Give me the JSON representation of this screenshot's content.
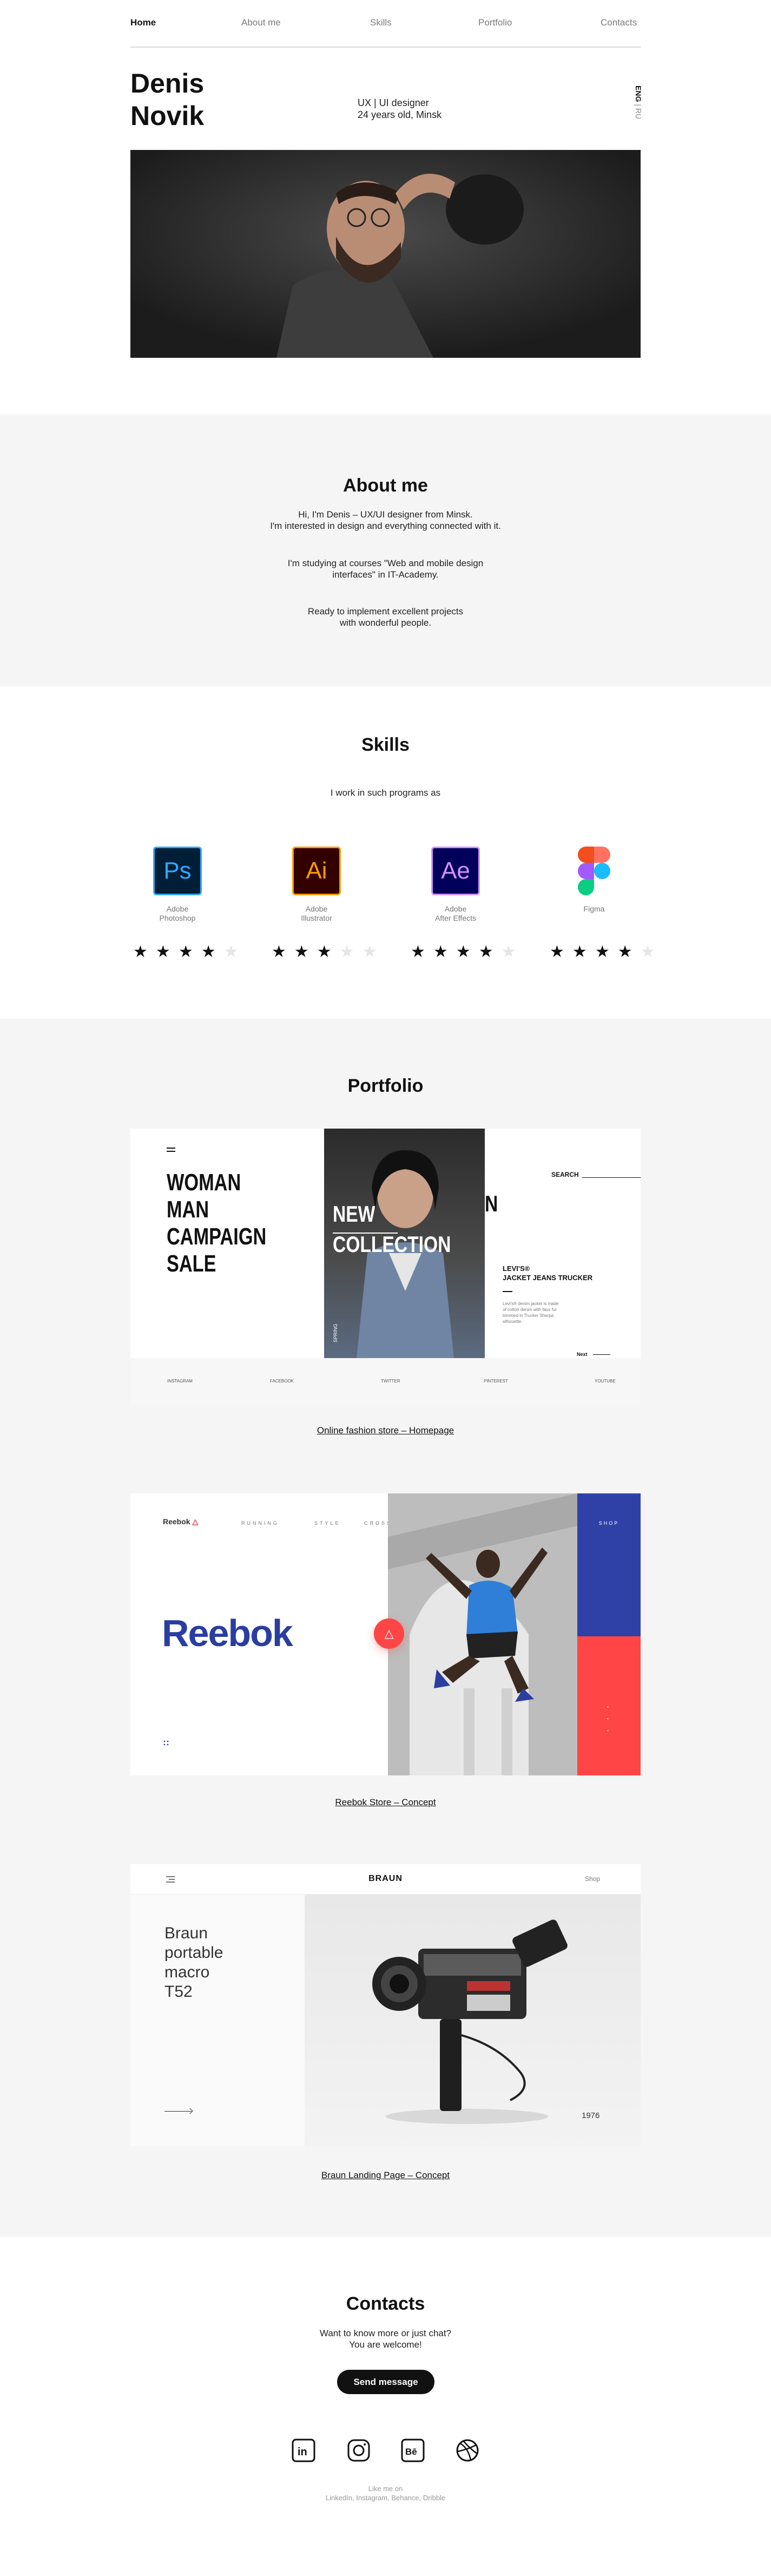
{
  "nav": {
    "items": [
      "Home",
      "About me",
      "Skills",
      "Portfolio",
      "Contacts"
    ],
    "active": "Home"
  },
  "hero": {
    "first_name": "Denis",
    "last_name": "Novik",
    "role": "UX | UI designer",
    "age_city": "24 years old, Minsk",
    "lang_active": "ENG",
    "lang_other": "RU"
  },
  "about": {
    "title": "About me",
    "p1": "Hi, I'm Denis – UX/UI designer from Minsk.\nI'm interested in design and everything connected with it.",
    "p2": "I'm studying at courses \"Web and mobile design\ninterfaces\" in IT-Academy.",
    "p3": "Ready to implement excellent projects\nwith wonderful people."
  },
  "skills": {
    "title": "Skills",
    "subtitle": "I work in such programs as",
    "items": [
      {
        "abbr": "Ps",
        "label": "Adobe\nPhotoshop",
        "rating": 4,
        "color": "#31a8ff",
        "bg": "#001e36"
      },
      {
        "abbr": "Ai",
        "label": "Adobe\nIllustrator",
        "rating": 3,
        "color": "#ff9a00",
        "bg": "#330000"
      },
      {
        "abbr": "Ae",
        "label": "Adobe\nAfter Effects",
        "rating": 4,
        "color": "#d291ff",
        "bg": "#00005b"
      },
      {
        "abbr": "",
        "label": "Figma",
        "rating": 4,
        "color": "#f24e1e",
        "bg": "#ffffff"
      }
    ]
  },
  "portfolio": {
    "title": "Portfolio",
    "projects": [
      {
        "caption": "Online fashion store – Homepage",
        "campaign": [
          "WOMAN",
          "MAN",
          "CAMPAIGN",
          "SALE"
        ],
        "banner": [
          "NEW",
          "COLLECTION"
        ],
        "search": "SEARCH",
        "product": [
          "LEVI'S®",
          "JACKET JEANS TRUCKER"
        ],
        "product_desc": "Levi's® denim jacket is made of cotton denim with faux fur trimmed in Trucker Sherpa silhouette.",
        "more": "Next",
        "side_text": "SPRING",
        "footer_links": [
          "INSTAGRAM",
          "FACEBOOK",
          "TWITTER",
          "PINTEREST",
          "YOUTUBE"
        ]
      },
      {
        "caption": "Reebok Store – Concept",
        "brand": "Reebok",
        "logo_text": "Reebok",
        "menu": [
          "RUNNING",
          "STYLE",
          "CROSSFIT"
        ],
        "shop": "SHOP"
      },
      {
        "caption": "Braun Landing Page – Concept",
        "logo": "BRAUN",
        "shop": "Shop",
        "product": "Braun\nportable\nmacro\nT52",
        "year": "1976"
      }
    ]
  },
  "contacts": {
    "title": "Contacts",
    "text": "Want to know more or just chat?\nYou are welcome!",
    "button": "Send message",
    "footer_line1": "Like me on",
    "footer_line2": "LinkedIn, Instagram, Behance, Dribble",
    "social": [
      "linkedin-icon",
      "instagram-icon",
      "behance-icon",
      "dribbble-icon"
    ]
  }
}
